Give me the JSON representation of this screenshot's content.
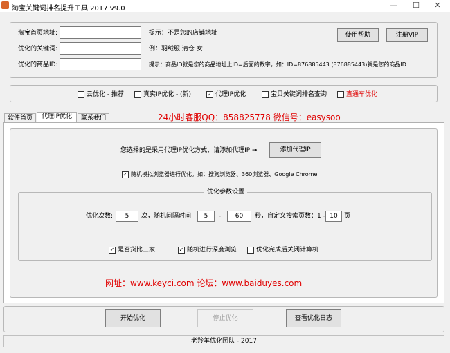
{
  "window": {
    "title": "淘宝关键词排名提升工具 2017 v9.0",
    "min_glyph": "—",
    "max_glyph": "☐",
    "close_glyph": "✕"
  },
  "form": {
    "shop_url_label": "淘宝首页地址:",
    "shop_url_value": "",
    "shop_url_hint": "提示：不是您的店铺地址",
    "keyword_label": "优化的关键词:",
    "keyword_value": "",
    "keyword_hint": "例：羽绒服 清仓 女",
    "product_id_label": "优化的商品ID:",
    "product_id_value": "",
    "product_id_hint": "提示：商品ID就是您的商品地址上ID=后面的数字，如：ID=876885443 (876885443)就是您的商品ID",
    "help_button": "使用帮助",
    "vip_button": "注册VIP"
  },
  "modes": [
    {
      "label": "云优化 - 推荐",
      "checked": false,
      "red": false
    },
    {
      "label": "真实IP优化 - (新)",
      "checked": false,
      "red": false
    },
    {
      "label": "代理IP优化",
      "checked": true,
      "red": false
    },
    {
      "label": "宝贝关键词排名查询",
      "checked": false,
      "red": false
    },
    {
      "label": "直通车优化",
      "checked": false,
      "red": true
    }
  ],
  "tabs": [
    {
      "label": "软件首页",
      "active": false
    },
    {
      "label": "代理IP优化",
      "active": true
    },
    {
      "label": "联系我们",
      "active": false
    }
  ],
  "banner": {
    "text": "24小时客服QQ：858825778 微信号：easysoo"
  },
  "proxy": {
    "prompt": "您选择的是采用代理IP优化方式，请添加代理IP ➞",
    "add_button": "添加代理IP",
    "simulate_label": "随机模拟浏览器进行优化。如：搜狗浏览器、360浏览器、Google Chrome",
    "simulate_checked": true
  },
  "params": {
    "title": "优化参数设置",
    "count_label": "优化次数:",
    "count_value": "5",
    "interval_label": "次，随机间隔时间:",
    "interval_min": "5",
    "dash": "-",
    "interval_max": "60",
    "pages_label": "秒，自定义搜索页数：1 -",
    "pages_value": "10",
    "pages_unit": "页",
    "compare_label": "是否货比三家",
    "compare_checked": true,
    "deep_label": "随机进行深度浏览",
    "deep_checked": true,
    "shutdown_label": "优化完成后关闭计算机",
    "shutdown_checked": false
  },
  "site_banner": {
    "text": "网址：www.keyci.com  论坛：www.baiduyes.com"
  },
  "actions": {
    "start": "开始优化",
    "stop": "停止优化",
    "log": "查看优化日志"
  },
  "footer": {
    "text": "老羚羊优化团队 - 2017"
  },
  "colors": {
    "red": "#e00000",
    "window_bg": "#f0f0f0"
  }
}
